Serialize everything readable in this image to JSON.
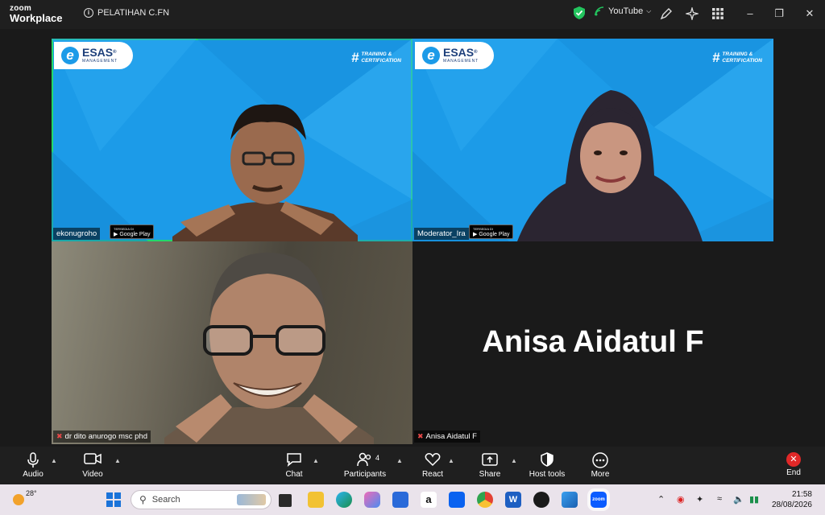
{
  "title_bar": {
    "brand_line1": "zoom",
    "brand_line2": "Workplace",
    "meeting_name": "PELATIHAN C.FN",
    "youtube_label": "YouTube",
    "info_icon": "info-icon",
    "shield_icon": "shield-check-icon"
  },
  "tiles": [
    {
      "name": "ekonugroho",
      "muted": false,
      "active_speaker": true,
      "background": "blue-virtual"
    },
    {
      "name": "Moderator_Ira",
      "muted": false,
      "active_speaker": false,
      "background": "blue-virtual"
    },
    {
      "name": "dr dito anurogo msc phd",
      "muted": true,
      "active_speaker": false,
      "background": "camera"
    },
    {
      "name": "Anisa Aidatul F",
      "muted": true,
      "active_speaker": false,
      "background": "none",
      "display_name_large": "Anisa Aidatul F"
    }
  ],
  "virtual_bg": {
    "logo_letter": "e",
    "logo_main": "ESAS",
    "logo_reg": "®",
    "logo_sub": "MANAGEMENT",
    "hash": "#",
    "tagline_line1": "TRAINING &",
    "tagline_line2": "CERTIFICATION",
    "gplay_small": "TERSEDIA DI",
    "gplay_main": "Google Play"
  },
  "toolbar": {
    "audio": "Audio",
    "video": "Video",
    "chat": "Chat",
    "participants": "Participants",
    "participants_count": "4",
    "react": "React",
    "share": "Share",
    "host_tools": "Host tools",
    "more": "More",
    "end": "End"
  },
  "taskbar": {
    "temperature": "28°",
    "search_placeholder": "Search",
    "time": "21:58",
    "date": "28/08/2026"
  },
  "colors": {
    "active_speaker_border": "#23d96a",
    "virtual_bg_blue": "#1c9be8",
    "end_red": "#e02828",
    "window_bg": "#1a1a1a"
  }
}
